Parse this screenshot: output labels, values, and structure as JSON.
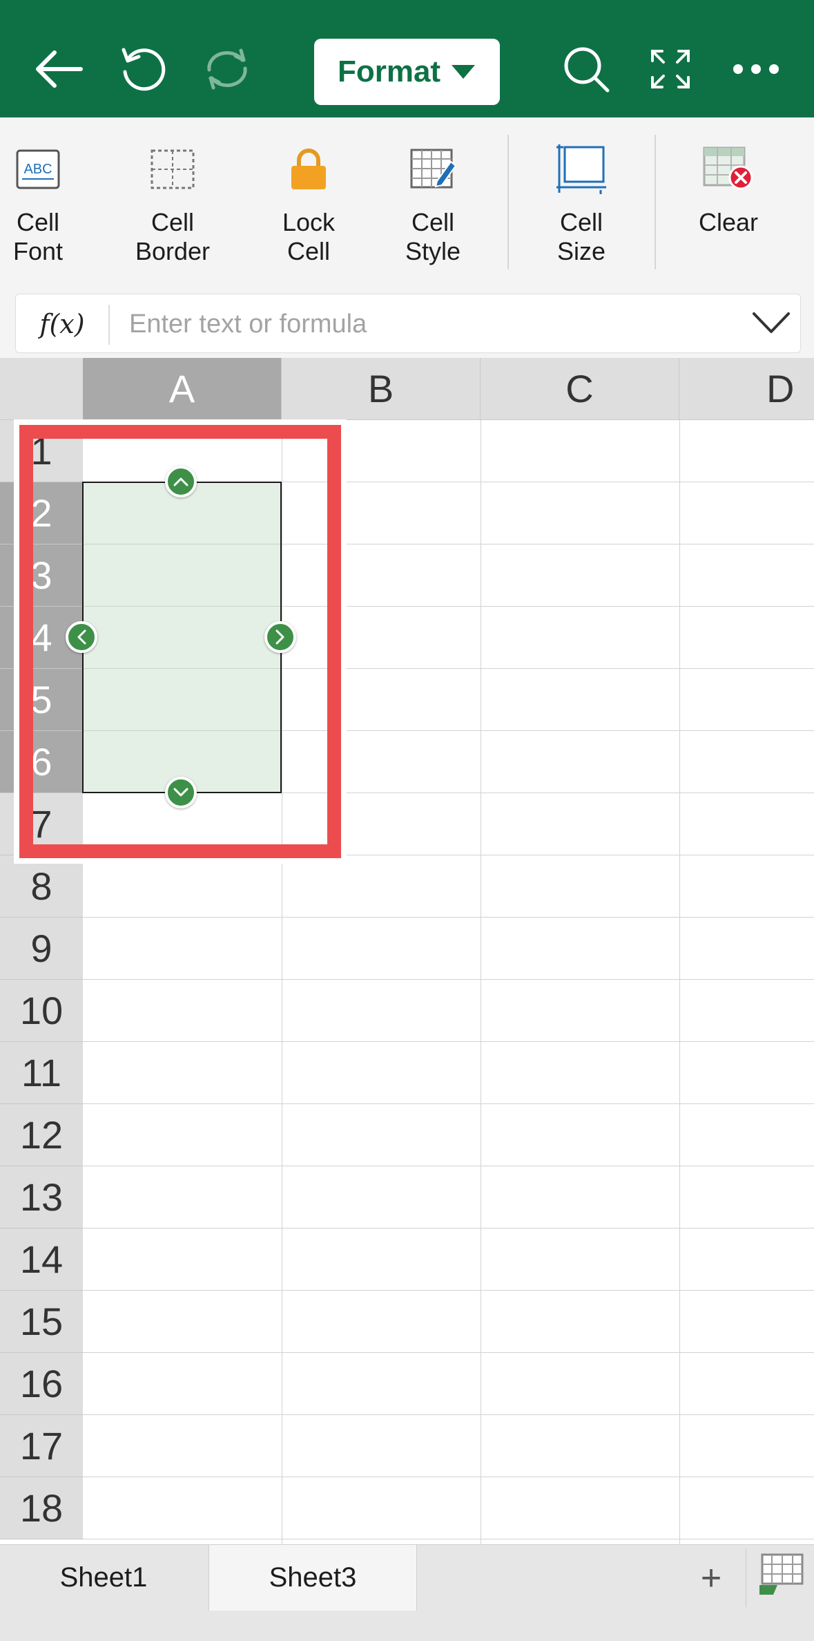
{
  "toolbar": {
    "back_icon": "arrow-left-icon",
    "undo_icon": "undo-icon",
    "redo_icon": "redo-icon",
    "format_label": "Format",
    "search_icon": "search-icon",
    "fullscreen_icon": "fullscreen-icon",
    "more_icon": "more-icon"
  },
  "ribbon": {
    "items": [
      {
        "label": "Cell\nFont",
        "icon": "cell-font-icon"
      },
      {
        "label": "Cell\nBorder",
        "icon": "cell-border-icon"
      },
      {
        "label": "Lock\nCell",
        "icon": "lock-icon"
      },
      {
        "label": "Cell\nStyle",
        "icon": "cell-style-icon"
      },
      {
        "label": "Cell\nSize",
        "icon": "cell-size-icon"
      },
      {
        "label": "Clear",
        "icon": "clear-icon"
      }
    ],
    "cell_font_icon_text": "ABC"
  },
  "formula_bar": {
    "fx_label": "f(x)",
    "placeholder": "Enter text or formula",
    "value": ""
  },
  "grid": {
    "columns": [
      "A",
      "B",
      "C",
      "D"
    ],
    "selected_column": "A",
    "rows": [
      "1",
      "2",
      "3",
      "4",
      "5",
      "6",
      "7",
      "8",
      "9",
      "10",
      "11",
      "12",
      "13",
      "14",
      "15",
      "16",
      "17",
      "18"
    ],
    "selected_rows": [
      "2",
      "3",
      "4",
      "5",
      "6"
    ],
    "selection_range": "A2:A6"
  },
  "sheets": {
    "tabs": [
      "Sheet1",
      "Sheet3"
    ],
    "active": "Sheet3",
    "add_label": "+"
  },
  "colors": {
    "brand_green": "#0e7145",
    "highlight_red": "#ec4c4e",
    "handle_green": "#3e9048",
    "selection_fill": "#e3efe5"
  }
}
